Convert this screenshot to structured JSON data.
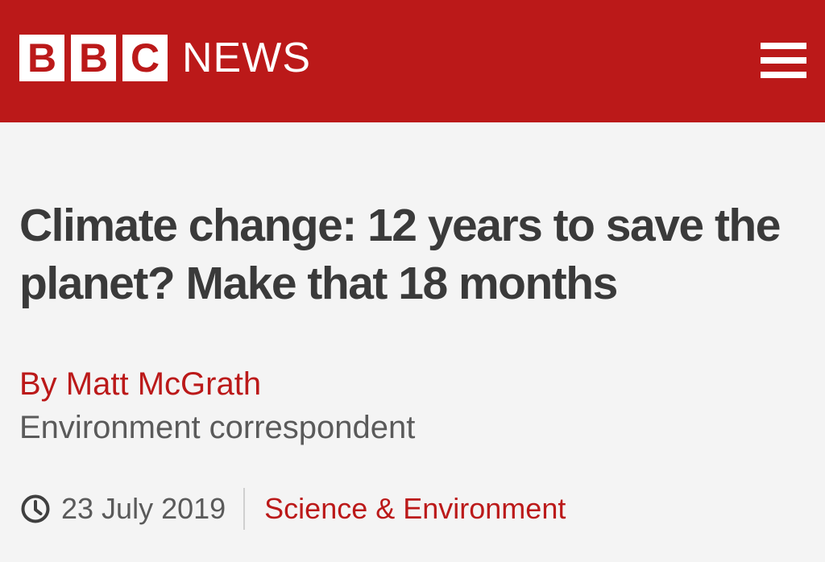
{
  "header": {
    "logo_letters": [
      "B",
      "B",
      "C"
    ],
    "logo_word": "NEWS",
    "menu_icon": "hamburger-menu-icon",
    "background_color": "#bb1919"
  },
  "article": {
    "headline": "Climate change: 12 years to save the planet? Make that 18 months",
    "byline": "By Matt McGrath",
    "author_role": "Environment correspondent",
    "date": "23 July 2019",
    "date_icon": "clock-icon",
    "section": "Science & Environment"
  },
  "colors": {
    "brand_red": "#bb1919",
    "headline_text": "#3a3a3a",
    "secondary_text": "#5a5a5a",
    "page_background": "#f4f4f4"
  }
}
